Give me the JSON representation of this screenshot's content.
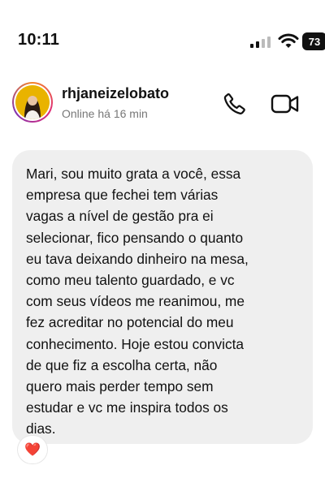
{
  "status_bar": {
    "time": "10:11",
    "battery": "73",
    "icons": [
      "signal-icon",
      "wifi-icon",
      "battery-icon"
    ]
  },
  "header": {
    "username": "rhjaneizelobato",
    "presence": "Online há 16 min",
    "actions": [
      "phone-icon",
      "video-camera-icon"
    ]
  },
  "message": {
    "text": "Mari, sou muito grata a  você,  essa\nempresa que fechei tem várias\nvagas a nível de gestão pra ei\nselecionar,  fico pensando o quanto\neu tava deixando dinheiro na mesa,\ncomo meu talento guardado,  e vc\ncom seus vídeos me reanimou,  me\nfez acreditar no potencial do meu\nconhecimento. Hoje estou convicta\nde que fiz a escolha certa,  não\nquero mais perder tempo sem\nestudar e vc me inspira todos os\ndias.",
    "reaction": "❤️"
  },
  "colors": {
    "bubble": "#efefef",
    "avatar_ring": [
      "#f58529",
      "#dd2a7b",
      "#8134af"
    ]
  }
}
